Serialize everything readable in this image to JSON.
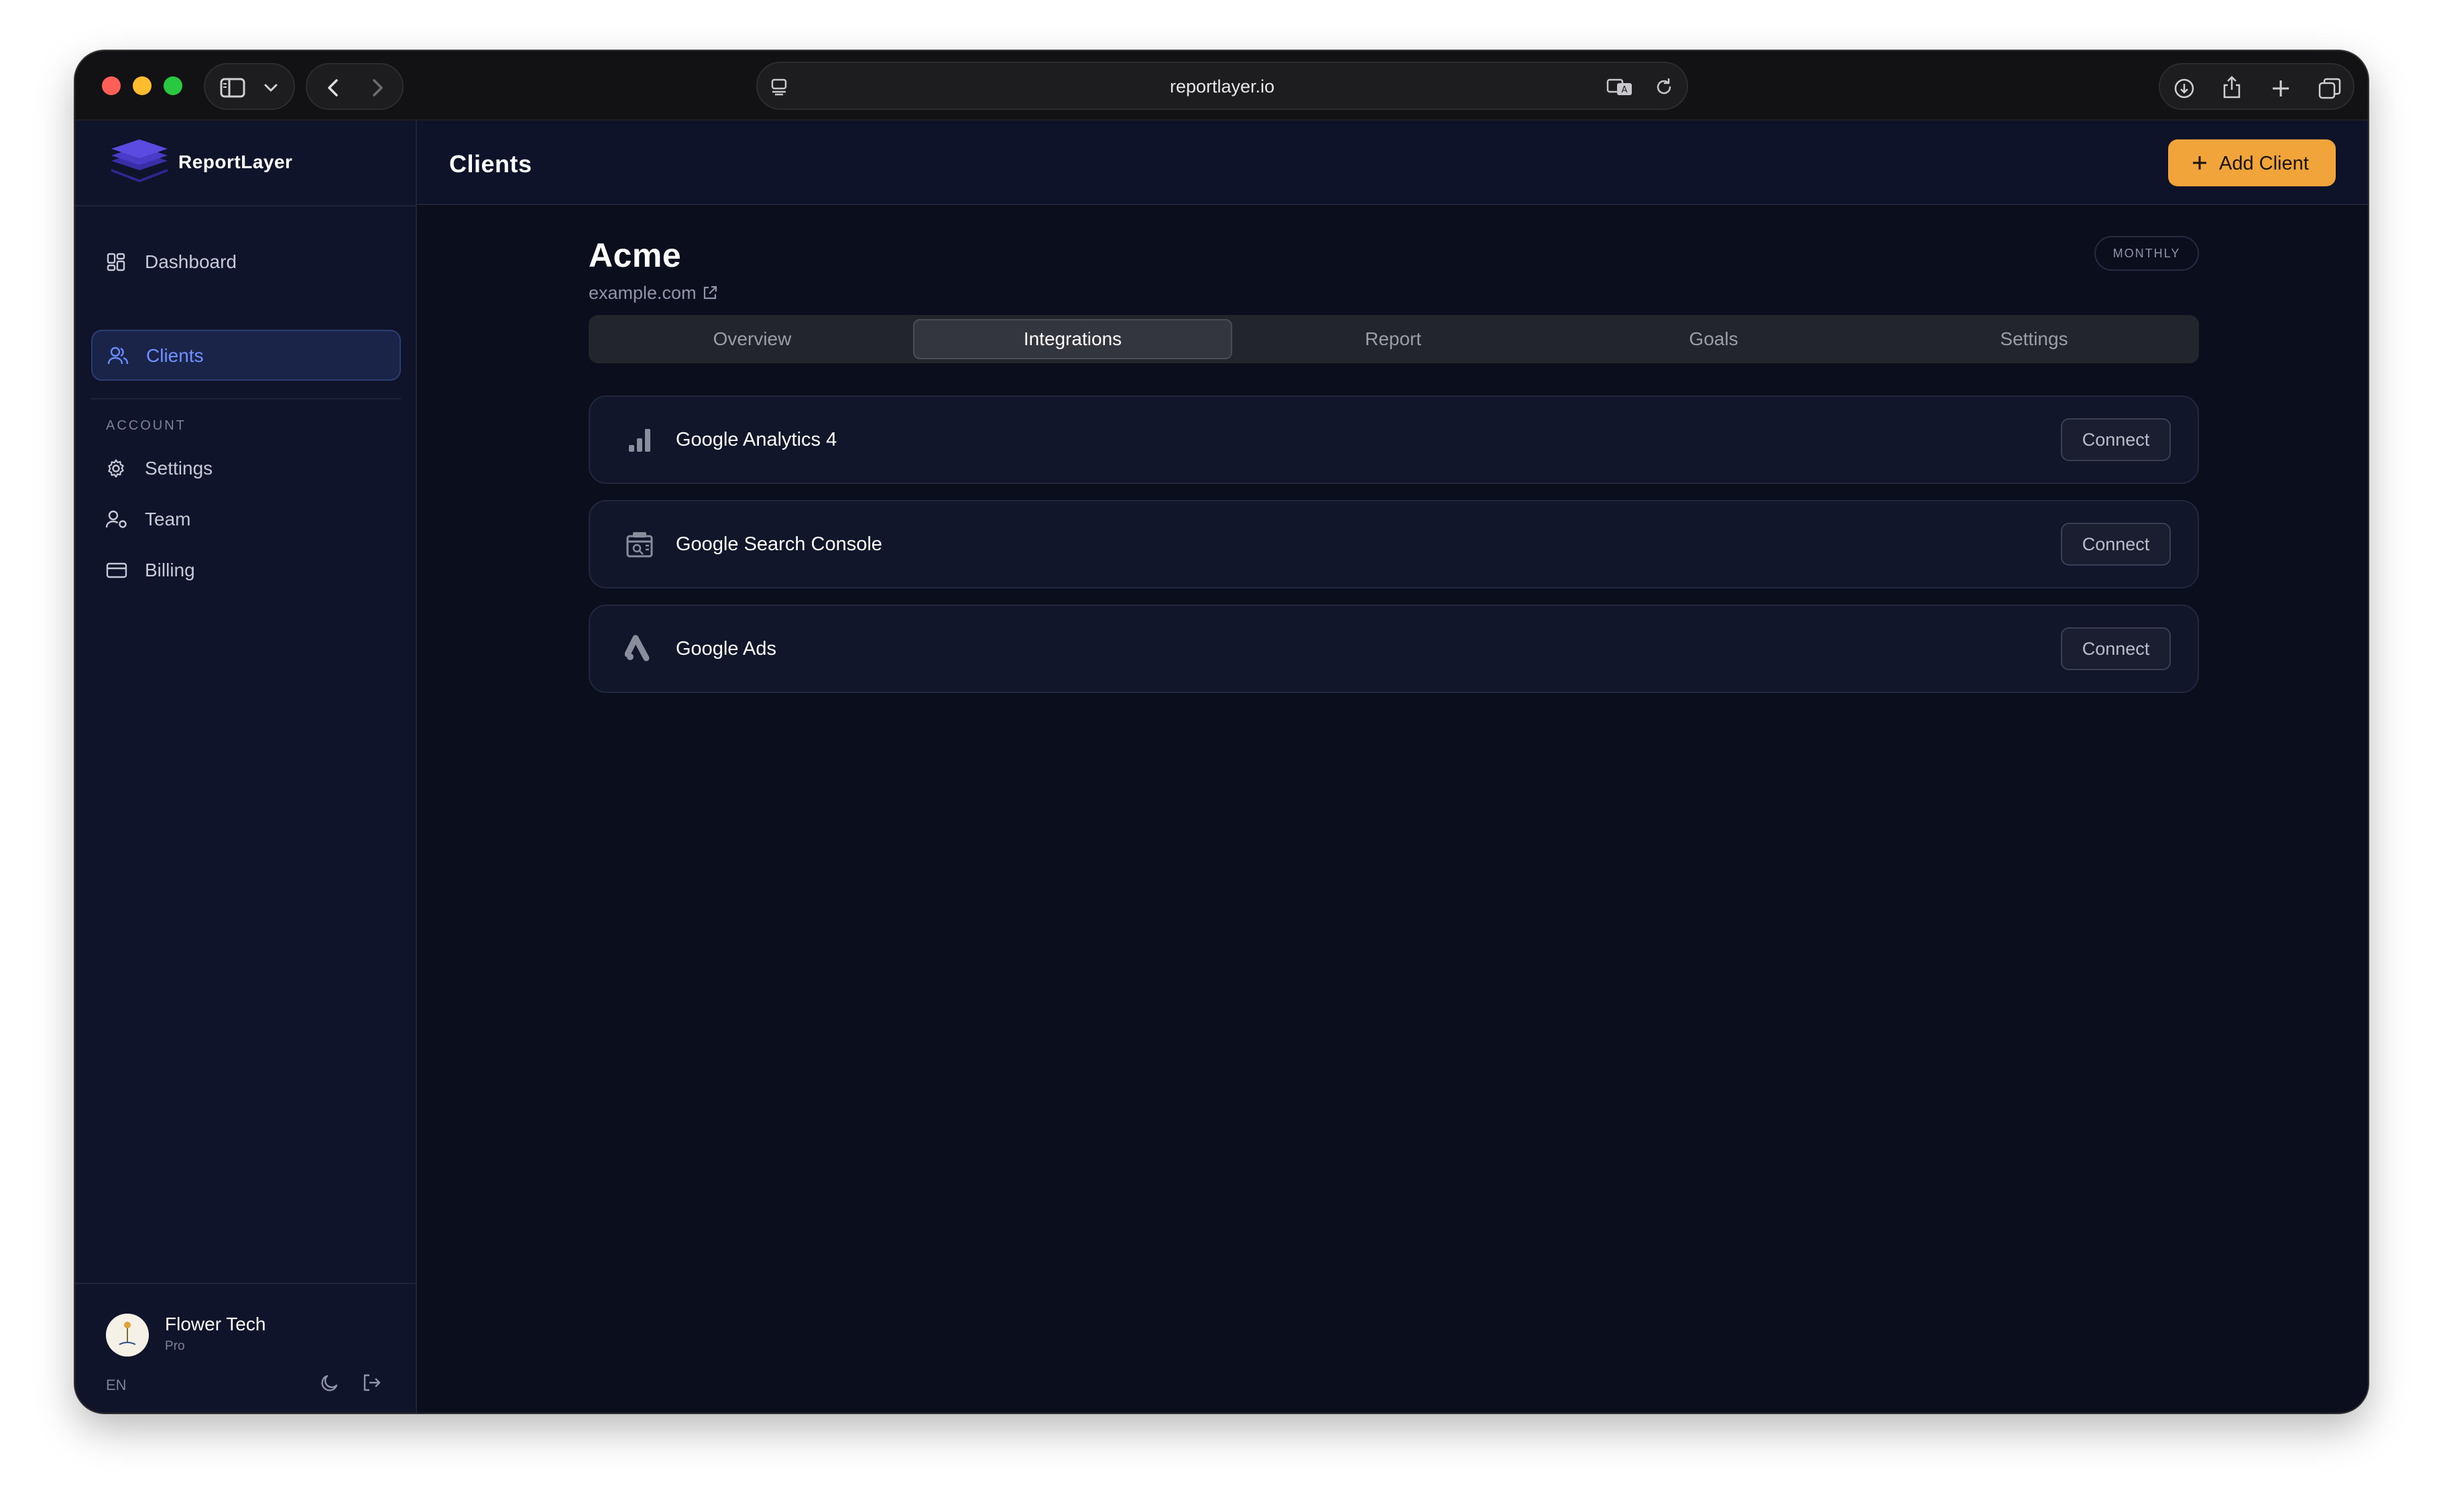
{
  "browser": {
    "url": "reportlayer.io"
  },
  "brand": {
    "name": "ReportLayer",
    "color": "#5b4be0"
  },
  "sidebar": {
    "nav": [
      {
        "label": "Dashboard",
        "icon": "dashboard-grid-icon",
        "active": false
      },
      {
        "label": "Clients",
        "icon": "users-icon",
        "active": true
      }
    ],
    "section_label": "ACCOUNT",
    "account": [
      {
        "label": "Settings",
        "icon": "gear-icon"
      },
      {
        "label": "Team",
        "icon": "team-icon"
      },
      {
        "label": "Billing",
        "icon": "credit-card-icon"
      }
    ],
    "user": {
      "name": "Flower Tech",
      "plan": "Pro"
    },
    "language": "EN"
  },
  "header": {
    "title": "Clients",
    "add_button": "Add Client",
    "accent": "#f0a43a"
  },
  "client": {
    "name": "Acme",
    "url": "example.com",
    "frequency": "MONTHLY"
  },
  "tabs": [
    {
      "label": "Overview",
      "active": false
    },
    {
      "label": "Integrations",
      "active": true
    },
    {
      "label": "Report",
      "active": false
    },
    {
      "label": "Goals",
      "active": false
    },
    {
      "label": "Settings",
      "active": false
    }
  ],
  "integrations": [
    {
      "name": "Google Analytics 4",
      "icon": "bar-chart-icon",
      "action": "Connect"
    },
    {
      "name": "Google Search Console",
      "icon": "search-console-icon",
      "action": "Connect"
    },
    {
      "name": "Google Ads",
      "icon": "google-ads-icon",
      "action": "Connect"
    }
  ]
}
